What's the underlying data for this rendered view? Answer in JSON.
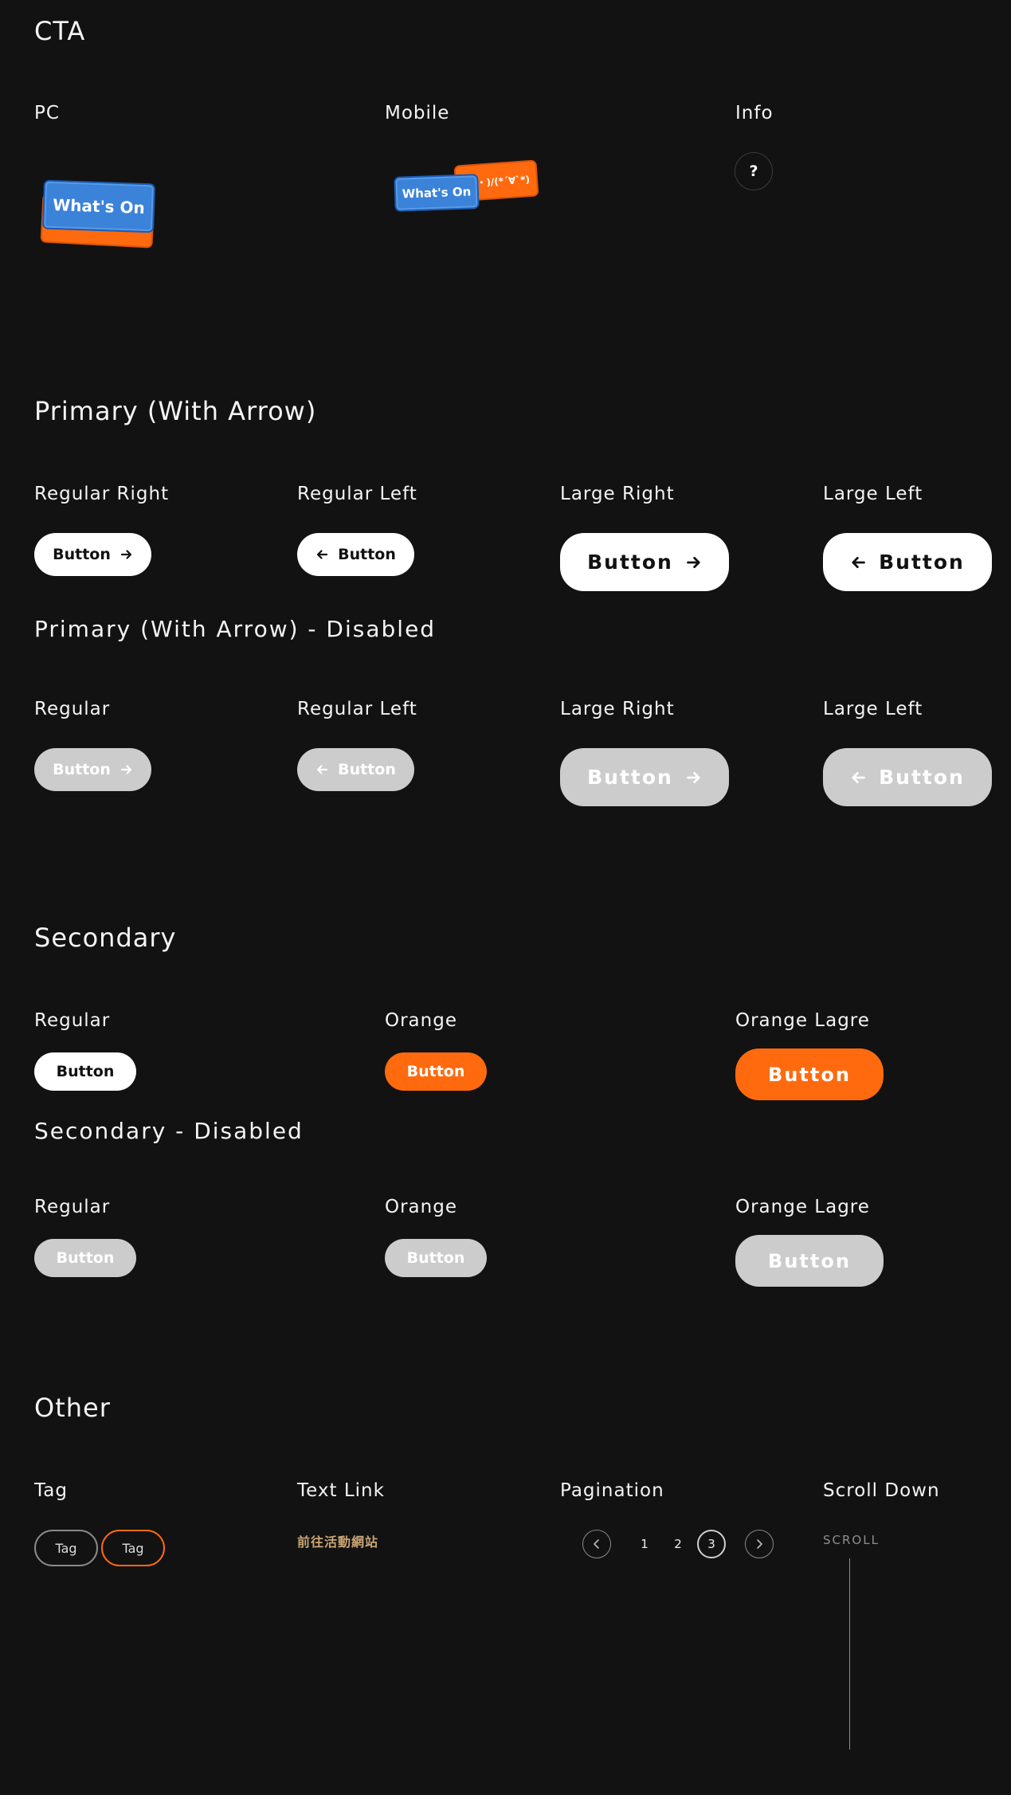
{
  "cta": {
    "title": "CTA",
    "pc_label": "PC",
    "mobile_label": "Mobile",
    "info_label": "Info",
    "card_text": "What's On",
    "mobile_orange_text": "(/・ω・)/(*´∀`*)",
    "info_symbol": "?"
  },
  "primary": {
    "title": "Primary (With Arrow)",
    "labels": [
      "Regular Right",
      "Regular Left",
      "Large Right",
      "Large Left"
    ],
    "button_label": "Button"
  },
  "primary_disabled": {
    "title": "Primary (With Arrow) - Disabled",
    "labels": [
      "Regular",
      "Regular Left",
      "Large Right",
      "Large Left"
    ],
    "button_label": "Button"
  },
  "secondary": {
    "title": "Secondary",
    "labels": [
      "Regular",
      "Orange",
      "Orange Lagre"
    ],
    "button_label": "Button"
  },
  "secondary_disabled": {
    "title": "Secondary - Disabled",
    "labels": [
      "Regular",
      "Orange",
      "Orange Lagre"
    ],
    "button_label": "Button"
  },
  "other": {
    "title": "Other",
    "tag_label": "Tag",
    "tags": [
      "Tag",
      "Tag"
    ],
    "text_link_label": "Text Link",
    "text_link": "前往活動網站",
    "pagination_label": "Pagination",
    "pages": [
      "1",
      "2",
      "3"
    ],
    "active_page": "3",
    "scroll_label": "Scroll Down",
    "scroll_text": "SCROLL"
  },
  "colors": {
    "background": "#121212",
    "orange": "#ff6a0f",
    "blue": "#3b82d9",
    "disabled": "#cccccc",
    "link": "#c9a574"
  }
}
